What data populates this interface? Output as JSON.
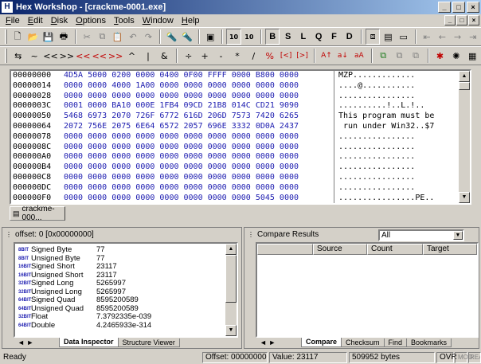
{
  "window": {
    "title": "Hex Workshop - [crackme-0001.exe]",
    "app_icon": "H",
    "minimize": "_",
    "maximize": "□",
    "close": "×"
  },
  "menu": [
    {
      "label": "File",
      "u": "F",
      "rest": "ile"
    },
    {
      "label": "Edit",
      "u": "E",
      "rest": "dit"
    },
    {
      "label": "Disk",
      "u": "D",
      "rest": "isk"
    },
    {
      "label": "Options",
      "u": "O",
      "rest": "ptions"
    },
    {
      "label": "Tools",
      "u": "T",
      "rest": "ools"
    },
    {
      "label": "Window",
      "u": "W",
      "rest": "indow"
    },
    {
      "label": "Help",
      "u": "H",
      "rest": "elp"
    }
  ],
  "toolbar1": {
    "byte_mode": "10",
    "word_mode": "10",
    "ops": [
      "B",
      "S",
      "L",
      "Q",
      "F",
      "D"
    ]
  },
  "toolbar2": {
    "ops": [
      "⇆",
      "~",
      "<<",
      ">>",
      "<<",
      "<<",
      ">>",
      "^",
      "|",
      "&",
      "÷",
      "+",
      "-",
      "*",
      "/",
      "%",
      "[<]",
      "[>]",
      "A↑",
      "a↓",
      "aA"
    ]
  },
  "hex": {
    "rows": [
      {
        "offset": "00000000",
        "bytes": "4D5A 5000 0200 0000 0400 0F00 FFFF 0000 B800 0000",
        "ascii": "MZP............."
      },
      {
        "offset": "00000014",
        "bytes": "0000 0000 4000 1A00 0000 0000 0000 0000 0000 0000",
        "ascii": "....@..........."
      },
      {
        "offset": "00000028",
        "bytes": "0000 0000 0000 0000 0000 0000 0000 0000 0000 0000",
        "ascii": "................"
      },
      {
        "offset": "0000003C",
        "bytes": "0001 0000 BA10 000E 1FB4 09CD 21B8 014C CD21 9090",
        "ascii": "..........!..L.!.."
      },
      {
        "offset": "00000050",
        "bytes": "5468 6973 2070 726F 6772 616D 206D 7573 7420 6265",
        "ascii": "This program must be"
      },
      {
        "offset": "00000064",
        "bytes": "2072 756E 2075 6E64 6572 2057 696E 3332 0D0A 2437",
        "ascii": " run under Win32..$7"
      },
      {
        "offset": "00000078",
        "bytes": "0000 0000 0000 0000 0000 0000 0000 0000 0000 0000",
        "ascii": "................"
      },
      {
        "offset": "0000008C",
        "bytes": "0000 0000 0000 0000 0000 0000 0000 0000 0000 0000",
        "ascii": "................"
      },
      {
        "offset": "000000A0",
        "bytes": "0000 0000 0000 0000 0000 0000 0000 0000 0000 0000",
        "ascii": "................"
      },
      {
        "offset": "000000B4",
        "bytes": "0000 0000 0000 0000 0000 0000 0000 0000 0000 0000",
        "ascii": "................"
      },
      {
        "offset": "000000C8",
        "bytes": "0000 0000 0000 0000 0000 0000 0000 0000 0000 0000",
        "ascii": "................"
      },
      {
        "offset": "000000DC",
        "bytes": "0000 0000 0000 0000 0000 0000 0000 0000 0000 0000",
        "ascii": "................"
      },
      {
        "offset": "000000F0",
        "bytes": "0000 0000 0000 0000 0000 0000 0000 0000 5045 0000",
        "ascii": "................PE.."
      }
    ]
  },
  "doc_tab": {
    "label": "crackme-000..."
  },
  "inspector": {
    "header": "offset: 0 [0x00000000]",
    "rows": [
      {
        "bits": "8BIT",
        "label": "Signed Byte",
        "value": "77"
      },
      {
        "bits": "8BIT",
        "label": "Unsigned Byte",
        "value": "77"
      },
      {
        "bits": "16BIT",
        "label": "Signed Short",
        "value": "23117"
      },
      {
        "bits": "16BIT",
        "label": "Unsigned Short",
        "value": "23117"
      },
      {
        "bits": "32BIT",
        "label": "Signed Long",
        "value": "5265997"
      },
      {
        "bits": "32BIT",
        "label": "Unsigned Long",
        "value": "5265997"
      },
      {
        "bits": "64BIT",
        "label": "Signed Quad",
        "value": "8595200589"
      },
      {
        "bits": "64BIT",
        "label": "Unsigned Quad",
        "value": "8595200589"
      },
      {
        "bits": "32BIT",
        "label": "Float",
        "value": "7.3792335e-039"
      },
      {
        "bits": "64BIT",
        "label": "Double",
        "value": "4.2465933e-314"
      }
    ],
    "tabs": [
      "Data Inspector",
      "Structure Viewer"
    ]
  },
  "compare": {
    "header": "Compare Results",
    "filter": "All",
    "columns": [
      "Source",
      "Count",
      "Target"
    ],
    "tabs": [
      "Compare",
      "Checksum",
      "Find",
      "Bookmarks"
    ]
  },
  "status": {
    "ready": "Ready",
    "offset": "Offset: 00000000",
    "value": "Value: 23117",
    "size": "509952 bytes",
    "ovr": "OVR",
    "mod": "MOD",
    "read": "READ"
  }
}
